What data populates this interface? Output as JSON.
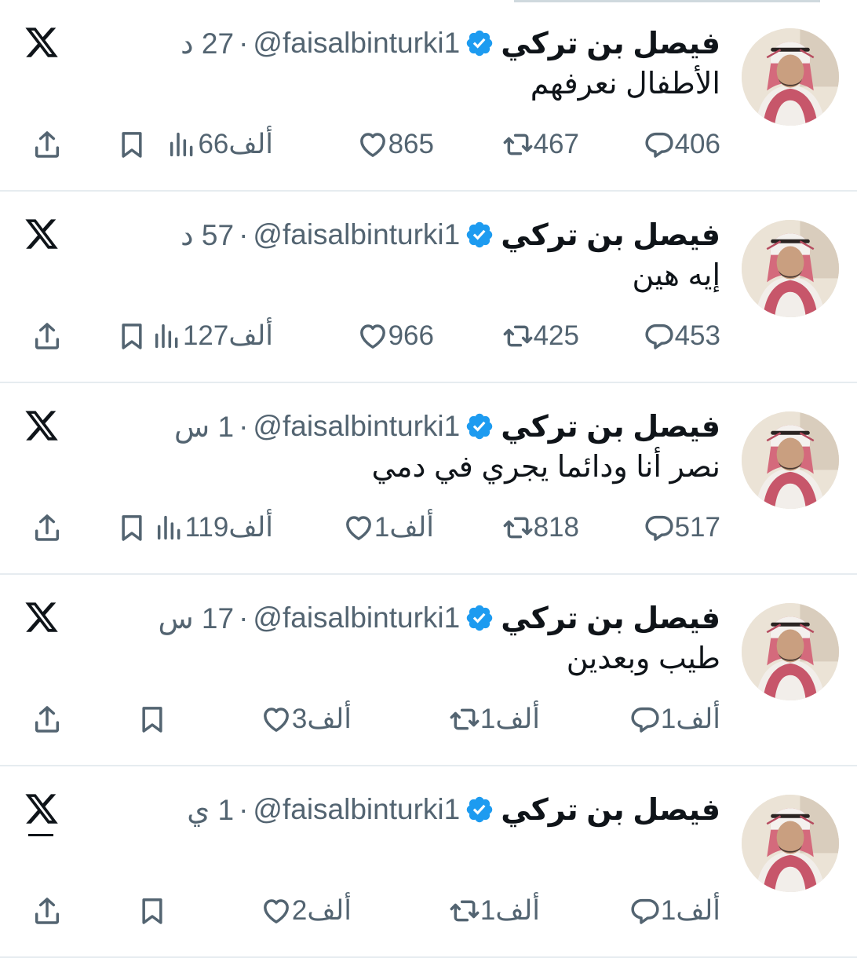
{
  "tweets": [
    {
      "name": "فيصل بن تركي",
      "handle": "@faisalbinturki1",
      "time": "27 د",
      "text": "الأطفال نعرفهم",
      "replies": "406",
      "reposts": "467",
      "likes": "865",
      "views": "66ألف"
    },
    {
      "name": "فيصل بن تركي",
      "handle": "@faisalbinturki1",
      "time": "57 د",
      "text": "إيه هين",
      "replies": "453",
      "reposts": "425",
      "likes": "966",
      "views": "127ألف"
    },
    {
      "name": "فيصل بن تركي",
      "handle": "@faisalbinturki1",
      "time": "1 س",
      "text": "نصر أنا ودائما يجري في دمي",
      "replies": "517",
      "reposts": "818",
      "likes": "1ألف",
      "views": "119ألف"
    },
    {
      "name": "فيصل بن تركي",
      "handle": "@faisalbinturki1",
      "time": "17 س",
      "text": "طيب وبعدين",
      "replies": "1ألف",
      "reposts": "1ألف",
      "likes": "3ألف",
      "views": ""
    },
    {
      "name": "فيصل بن تركي",
      "handle": "@faisalbinturki1",
      "time": "1 ي",
      "text": "—",
      "replies": "1ألف",
      "reposts": "1ألف",
      "likes": "2ألف",
      "views": ""
    }
  ],
  "icons": {
    "reply": "reply-icon",
    "repost": "repost-icon",
    "like": "heart-icon",
    "views": "views-icon",
    "bookmark": "bookmark-icon",
    "share": "share-icon",
    "verified": "verified-badge-icon",
    "logo": "x-logo-icon"
  },
  "colors": {
    "text": "#0f1419",
    "secondary": "#536471",
    "verified": "#1d9bf0",
    "divider": "#e6ecf0"
  }
}
